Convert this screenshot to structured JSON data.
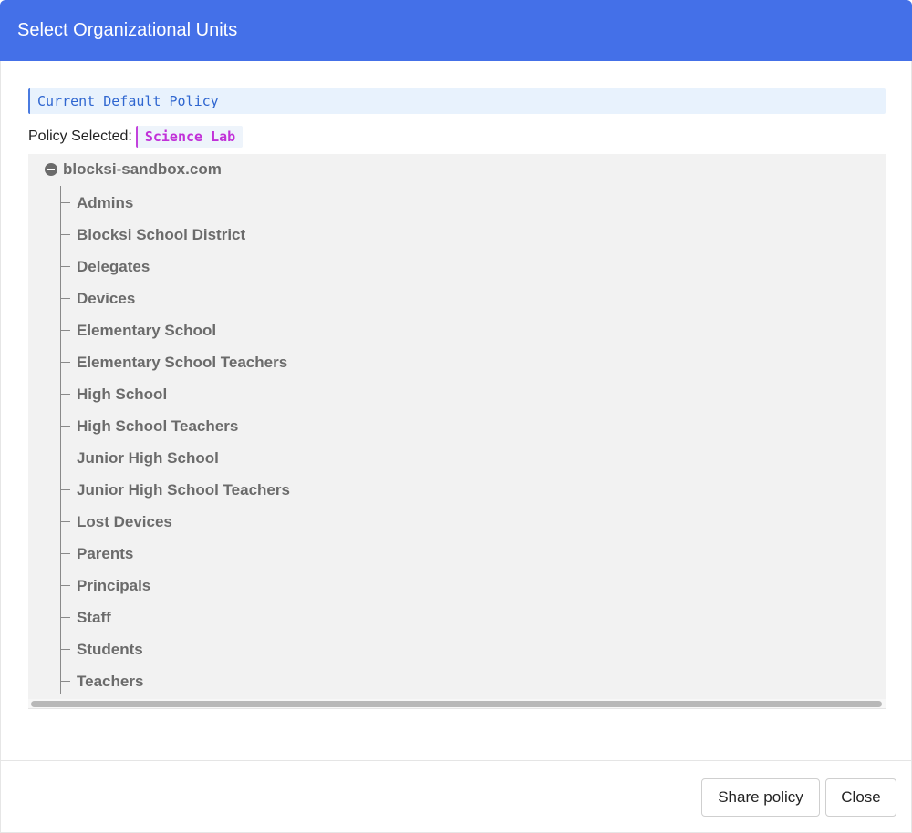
{
  "dialog": {
    "title": "Select Organizational Units"
  },
  "current_policy": {
    "label": "Current Default Policy"
  },
  "policy_selected": {
    "label": "Policy Selected:",
    "value": "Science Lab"
  },
  "tree": {
    "root_label": "blocksi-sandbox.com",
    "children": [
      "Admins",
      "Blocksi School District",
      "Delegates",
      "Devices",
      "Elementary School",
      "Elementary School Teachers",
      "High School",
      "High School Teachers",
      "Junior High School",
      "Junior High School Teachers",
      "Lost Devices",
      "Parents",
      "Principals",
      "Staff",
      "Students",
      "Teachers"
    ]
  },
  "footer": {
    "share_label": "Share policy",
    "close_label": "Close"
  },
  "colors": {
    "header_bg": "#4470e8",
    "policy_badge_accent": "#c131d8",
    "current_policy_accent": "#2f66d0"
  }
}
